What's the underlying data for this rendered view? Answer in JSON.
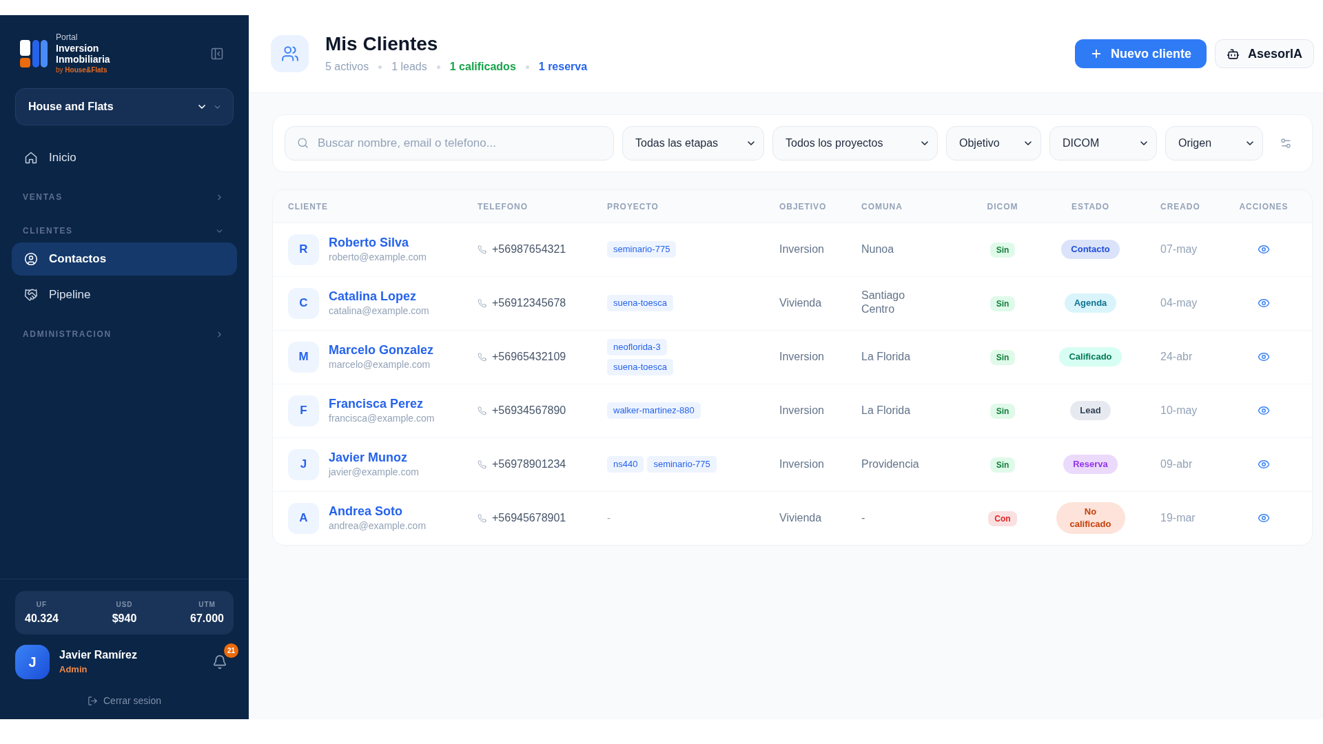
{
  "sidebar": {
    "brand": {
      "eyebrow": "Portal",
      "name": [
        "Inversion",
        "Inmobiliaria"
      ],
      "byline": "by **House&Flats**"
    },
    "workspace": {
      "label": "House and Flats"
    },
    "nav": [
      {
        "kind": "link",
        "label": "Inicio",
        "selected": false
      },
      {
        "kind": "section",
        "label": "VENTAS",
        "expanded": false
      },
      {
        "kind": "section",
        "label": "CLIENTES",
        "expanded": true,
        "children": [
          {
            "label": "Contactos",
            "selected": true
          },
          {
            "label": "Pipeline",
            "selected": false
          }
        ]
      },
      {
        "kind": "section",
        "label": "ADMINISTRACION",
        "expanded": false
      }
    ],
    "rates": [
      {
        "label": "UF",
        "value": "40.324"
      },
      {
        "label": "USD",
        "value": "$940"
      },
      {
        "label": "UTM",
        "value": "67.000"
      }
    ],
    "user": {
      "initial": "J",
      "name": "Javier Ramírez",
      "role": "Admin",
      "notifications": "21"
    },
    "logout": "Cerrar sesion"
  },
  "header": {
    "title": "Mis Clientes",
    "stats": [
      {
        "label": "5 activos",
        "kind": "plain",
        "color": "#94a3b8"
      },
      {
        "label": "1 leads",
        "kind": "plain",
        "color": "#94a3b8"
      },
      {
        "label": "1 calificados",
        "kind": "highlight",
        "color": "#16a34a"
      },
      {
        "label": "1 reserva",
        "kind": "highlight",
        "color": "#2563eb"
      }
    ],
    "actions": [
      {
        "kind": "primary",
        "label": "Nuevo cliente"
      },
      {
        "kind": "secondary",
        "label": "AsesorIA"
      }
    ]
  },
  "filters": {
    "search": {
      "placeholder": "Buscar nombre, email o telefono..."
    },
    "selects": [
      "Todas las etapas",
      "Todos los proyectos",
      "Objetivo",
      "DICOM",
      "Origen"
    ]
  },
  "table": {
    "columns": [
      "CLIENTE",
      "TELEFONO",
      "PROYECTO",
      "OBJETIVO",
      "COMUNA",
      "DICOM",
      "ESTADO",
      "CREADO",
      "ACCIONES"
    ],
    "rows": [
      {
        "initial": "R",
        "name": "Roberto Silva",
        "email": "roberto@example.com",
        "phone": "+56987654321",
        "proyecto": [
          "seminario-775"
        ],
        "objetivo": "Inversion",
        "comuna": "Nunoa",
        "dicom": {
          "label": "Sin",
          "color": "#15803d"
        },
        "estado": {
          "label": "Contacto",
          "color": "#1d4ed8"
        },
        "creado": "07-may"
      },
      {
        "initial": "C",
        "name": "Catalina Lopez",
        "email": "catalina@example.com",
        "phone": "+56912345678",
        "proyecto": [
          "suena-toesca"
        ],
        "objetivo": "Vivienda",
        "comuna": "Santiago Centro",
        "dicom": {
          "label": "Sin",
          "color": "#15803d"
        },
        "estado": {
          "label": "Agenda",
          "color": "#0e7490"
        },
        "creado": "04-may"
      },
      {
        "initial": "M",
        "name": "Marcelo Gonzalez",
        "email": "marcelo@example.com",
        "phone": "+56965432109",
        "proyecto": [
          "neoflorida-3",
          "suena-toesca"
        ],
        "objetivo": "Inversion",
        "comuna": "La Florida",
        "dicom": {
          "label": "Sin",
          "color": "#15803d"
        },
        "estado": {
          "label": "Calificado",
          "color": "#047857"
        },
        "creado": "24-abr"
      },
      {
        "initial": "F",
        "name": "Francisca Perez",
        "email": "francisca@example.com",
        "phone": "+56934567890",
        "proyecto": [
          "walker-martinez-880"
        ],
        "objetivo": "Inversion",
        "comuna": "La Florida",
        "dicom": {
          "label": "Sin",
          "color": "#15803d"
        },
        "estado": {
          "label": "Lead",
          "color": "#334155"
        },
        "creado": "10-may"
      },
      {
        "initial": "J",
        "name": "Javier Munoz",
        "email": "javier@example.com",
        "phone": "+56978901234",
        "proyecto": [
          "ns440",
          "seminario-775"
        ],
        "objetivo": "Inversion",
        "comuna": "Providencia",
        "dicom": {
          "label": "Sin",
          "color": "#15803d"
        },
        "estado": {
          "label": "Reserva",
          "color": "#9333ea"
        },
        "creado": "09-abr"
      },
      {
        "initial": "A",
        "name": "Andrea Soto",
        "email": "andrea@example.com",
        "phone": "+56945678901",
        "proyecto": "-",
        "objetivo": "Vivienda",
        "comuna": "-",
        "dicom": {
          "label": "Con",
          "color": "#dc2626"
        },
        "estado": {
          "label": "No calificado",
          "color": "#c2410c"
        },
        "creado": "19-mar"
      }
    ]
  }
}
